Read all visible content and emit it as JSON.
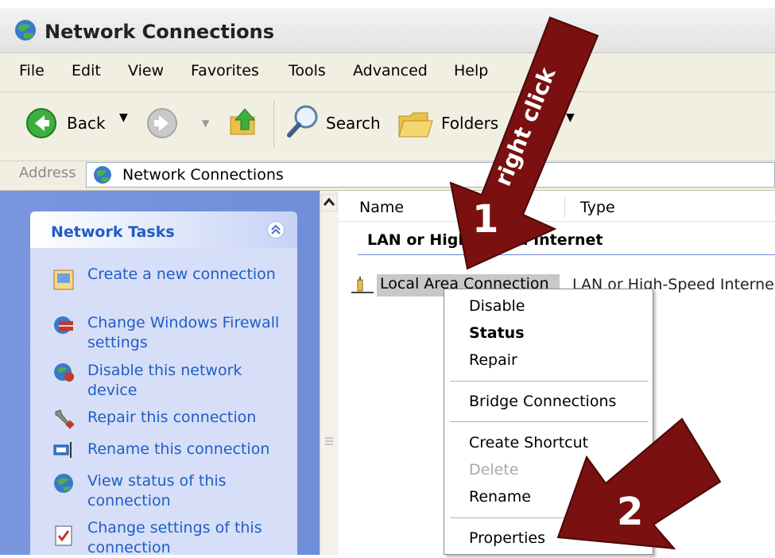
{
  "window": {
    "title": "Network Connections"
  },
  "menu": [
    "File",
    "Edit",
    "View",
    "Favorites",
    "Tools",
    "Advanced",
    "Help"
  ],
  "toolbar": {
    "back": "Back",
    "search": "Search",
    "folders": "Folders"
  },
  "address": {
    "label": "Address",
    "value": "Network Connections"
  },
  "tasks": {
    "title": "Network Tasks",
    "items": [
      {
        "label": "Create a new connection",
        "icon": "new-connection-icon"
      },
      {
        "label": "Change Windows Firewall settings",
        "icon": "firewall-icon"
      },
      {
        "label": "Disable this network device",
        "icon": "disable-device-icon"
      },
      {
        "label": "Repair this connection",
        "icon": "repair-icon"
      },
      {
        "label": "Rename this connection",
        "icon": "rename-icon"
      },
      {
        "label": "View status of this connection",
        "icon": "status-icon"
      },
      {
        "label": "Change settings of this connection",
        "icon": "settings-icon"
      }
    ]
  },
  "list": {
    "columns": [
      "Name",
      "Type"
    ],
    "group": "LAN or High-Speed Internet",
    "rows": [
      {
        "name": "Local Area Connection",
        "type": "LAN or High-Speed Interne"
      }
    ]
  },
  "context_menu": {
    "items": [
      "Disable",
      "Status",
      "Repair",
      "Bridge Connections",
      "Create Shortcut",
      "Delete",
      "Rename",
      "Properties"
    ]
  },
  "annotations": {
    "arrow1_label": "right click",
    "arrow1_number": "1",
    "arrow2_number": "2",
    "arrow_color": "#7a1010"
  },
  "colors": {
    "task_link": "#215dc6",
    "pane_blue": "#7a96df"
  }
}
